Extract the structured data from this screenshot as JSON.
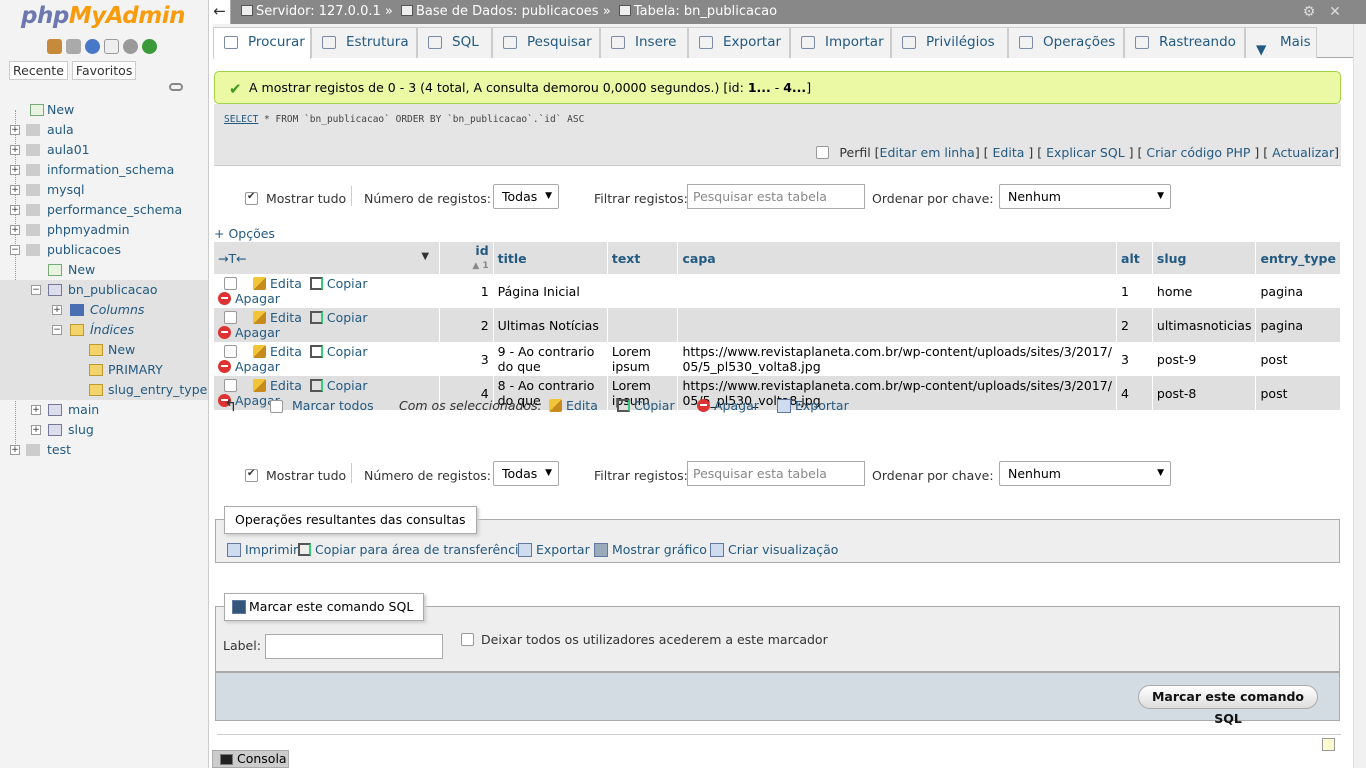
{
  "logo": {
    "part1": "php",
    "part2": "MyAdmin"
  },
  "nav": {
    "recent_label": "Recente",
    "favorites_label": "Favoritos",
    "new_label": "New",
    "databases": [
      "aula",
      "aula01",
      "information_schema",
      "mysql",
      "performance_schema",
      "phpmyadmin",
      "publicacoes"
    ],
    "pub_new": "New",
    "table_name": "bn_publicacao",
    "columns_label": "Columns",
    "indexes_label": "Índices",
    "idx_new": "New",
    "idx_primary": "PRIMARY",
    "idx_slug": "slug_entry_type",
    "other_tables": [
      "main",
      "slug"
    ],
    "db_test": "test"
  },
  "breadcrumb": {
    "server": "Servidor: 127.0.0.1 »",
    "database": "Base de Dados: publicacoes »",
    "table": "Tabela: bn_publicacao"
  },
  "tabs": [
    "Procurar",
    "Estrutura",
    "SQL",
    "Pesquisar",
    "Insere",
    "Exportar",
    "Importar",
    "Privilégios",
    "Operações",
    "Rastreando",
    "Mais"
  ],
  "success_msg": {
    "text": "A mostrar registos de 0 - 3 (4 total, A consulta demorou 0,0000 segundos.) [id: ",
    "bold1": "1...",
    "mid": " - ",
    "bold2": "4...",
    "end": "]"
  },
  "sql": {
    "keyword": "SELECT",
    "rest": " * FROM `bn_publicacao` ORDER BY `bn_publicacao`.`id` ASC",
    "perfil": "Perfil",
    "links": [
      "Editar em linha",
      "Edita",
      "Explicar SQL",
      "Criar código PHP",
      "Actualizar"
    ]
  },
  "navbar": {
    "show_all": "Mostrar tudo",
    "num_records": "Número de registos:",
    "num_value": "Todas",
    "filter_label": "Filtrar registos:",
    "filter_placeholder": "Pesquisar esta tabela",
    "order_label": "Ordenar por chave:",
    "order_value": "Nenhum"
  },
  "options_label": "+ Opções",
  "table": {
    "headers": [
      "id",
      "title",
      "text",
      "capa",
      "alt",
      "slug",
      "entry_type"
    ],
    "row_actions": {
      "edit": "Edita",
      "copy": "Copiar",
      "delete": "Apagar"
    },
    "rows": [
      {
        "id": "1",
        "title": "Página Inicial",
        "text": "",
        "capa": "",
        "alt": "1",
        "slug": "home",
        "entry_type": "pagina"
      },
      {
        "id": "2",
        "title": "Ultimas Notícias",
        "text": "",
        "capa": "",
        "alt": "2",
        "slug": "ultimasnoticias",
        "entry_type": "pagina"
      },
      {
        "id": "3",
        "title": "9 - Ao contrario do que",
        "text": "Lorem ipsum",
        "capa": "https://www.revistaplaneta.com.br/wp-content/uploads/sites/3/2017/05/5_pl530_volta8.jpg",
        "alt": "3",
        "slug": "post-9",
        "entry_type": "post"
      },
      {
        "id": "4",
        "title": "8 - Ao contrario do que",
        "text": "Lorem ipsum",
        "capa": "https://www.revistaplaneta.com.br/wp-content/uploads/sites/3/2017/05/5_pl530_volta8.jpg",
        "alt": "4",
        "slug": "post-8",
        "entry_type": "post"
      }
    ]
  },
  "bulk": {
    "mark_all": "Marcar todos",
    "with_selected": "Com os seleccionados:",
    "edit": "Edita",
    "copy": "Copiar",
    "delete": "Apagar",
    "export": "Exportar"
  },
  "query_results": {
    "legend": "Operações resultantes das consultas",
    "print": "Imprimir",
    "copy_clip": "Copiar para área de transferência",
    "export": "Exportar",
    "chart": "Mostrar gráfico",
    "view": "Criar visualização"
  },
  "bookmark": {
    "legend": "Marcar este comando SQL",
    "label": "Label:",
    "share": "Deixar todos os utilizadores acederem a este marcador",
    "button": "Marcar este comando SQL"
  },
  "console_label": "Consola",
  "colors": {
    "link": "#235a81",
    "success_bg": "#ebf8a4",
    "topbar": "#888888"
  }
}
